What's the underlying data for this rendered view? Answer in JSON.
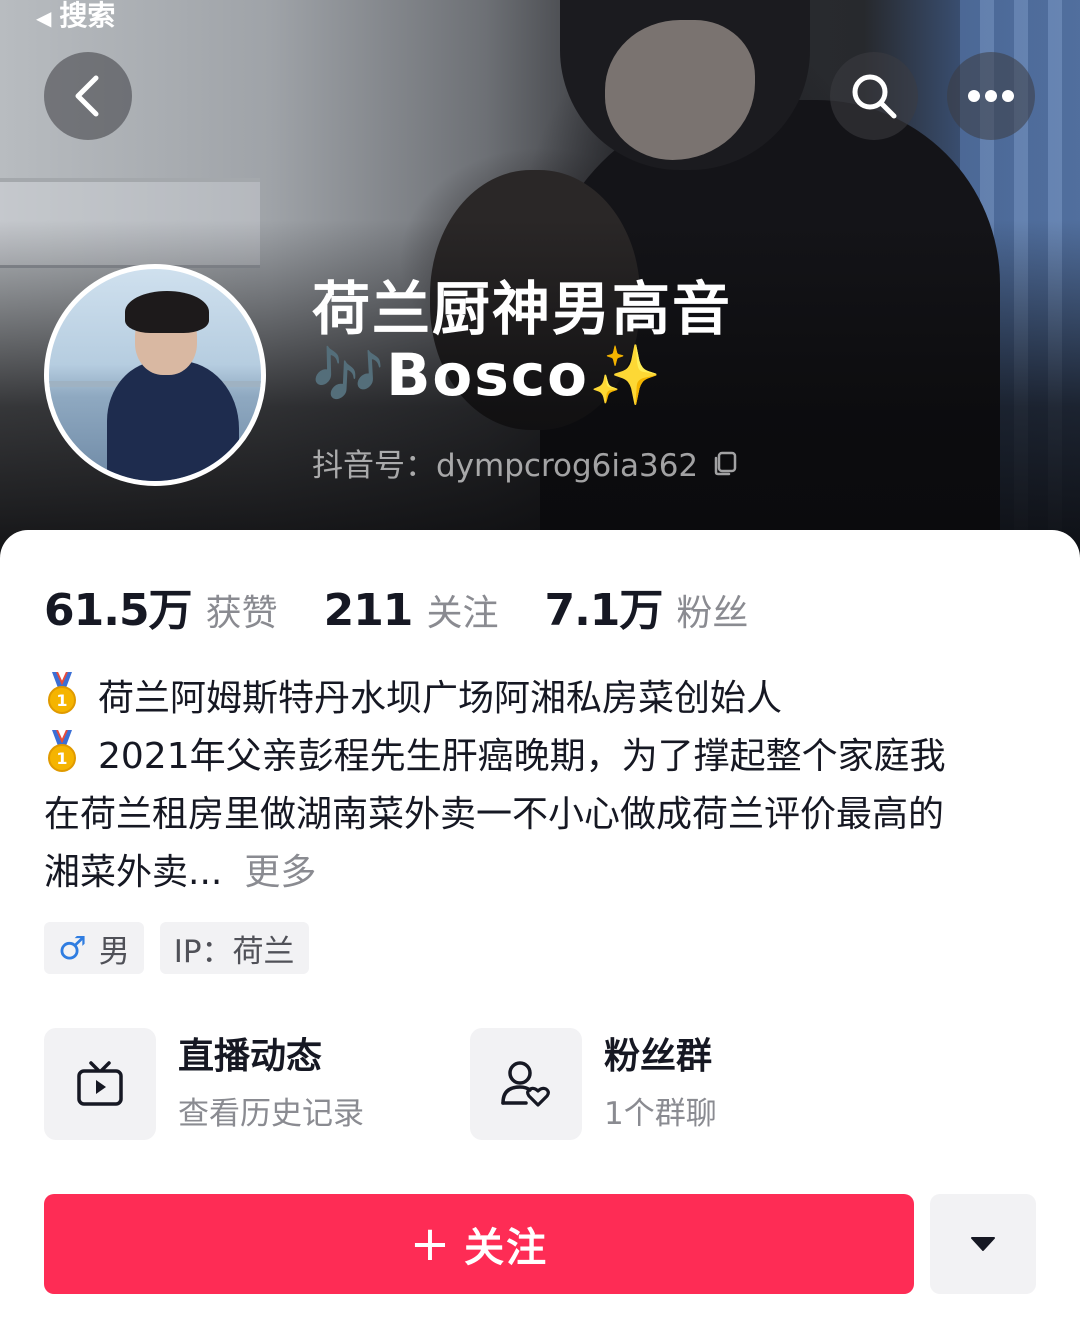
{
  "status_bar": {
    "back_app_label": "搜索"
  },
  "header": {
    "nickname": "荷兰厨神男高音🎶Bosco✨",
    "douyin_id": "抖音号：dympcrog6ia362"
  },
  "stats": [
    {
      "value": "61.5万",
      "label": "获赞"
    },
    {
      "value": "211",
      "label": "关注"
    },
    {
      "value": "7.1万",
      "label": "粉丝"
    }
  ],
  "bio": {
    "lines": [
      "荷兰阿姆斯特丹水坝广场阿湘私房菜创始人",
      "2021年父亲彭程先生肝癌晚期，为了撑起整个家庭我",
      "在荷兰租房里做湖南菜外卖一不小心做成荷兰评价最高的",
      "湘菜外卖..."
    ],
    "more_label": "更多"
  },
  "tags": {
    "gender_symbol": "♂",
    "gender": "男",
    "ip": "IP：荷兰"
  },
  "features": [
    {
      "title": "直播动态",
      "subtitle": "查看历史记录",
      "icon": "tv-play-icon"
    },
    {
      "title": "粉丝群",
      "subtitle": "1个群聊",
      "icon": "user-heart-icon"
    }
  ],
  "actions": {
    "follow_plus": "+",
    "follow_label": "关注"
  },
  "colors": {
    "accent": "#fe2c55",
    "muted_text": "#8a8b91",
    "chip_bg": "#f2f2f4",
    "male_blue": "#2f7de1"
  }
}
